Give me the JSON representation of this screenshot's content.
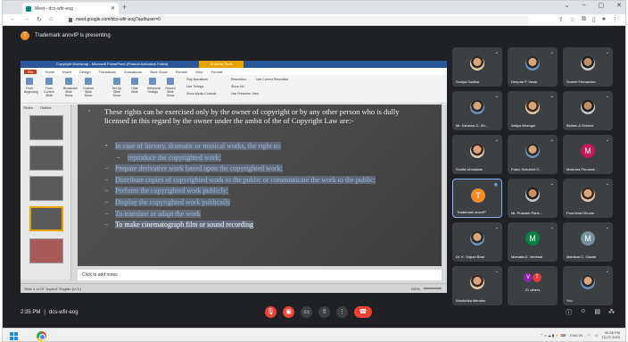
{
  "browser": {
    "tab_title": "Meet - dcs-wfir-eog",
    "url": "meet.google.com/dcs-wfir-eog?authuser=0"
  },
  "meet": {
    "presenter_initial": "T",
    "presenting_text": "Trademark anovIP is presenting",
    "time": "2:35 PM",
    "separator": "|",
    "meeting_code": "dcs-wfir-eog"
  },
  "powerpoint": {
    "title_bar": "Copyright Workshop - Microsoft PowerPoint (Product Activation Failed)",
    "drawing_tools": "Drawing Tools",
    "tabs": [
      "File",
      "Home",
      "Insert",
      "Design",
      "Transitions",
      "Animations",
      "Slide Show",
      "Review",
      "View",
      "Format"
    ],
    "ribbon_buttons": [
      "From Beginning",
      "From Current Slide",
      "Broadcast Slide Show",
      "Custom Slide Show",
      "Set Up Slide Show",
      "Hide Slide",
      "Rehearse Timings",
      "Record Slide Show"
    ],
    "ribbon_checks": [
      "Play Narrations",
      "Use Timings",
      "Show Media Controls",
      "Resolution:",
      "Use Current Resolution",
      "Show On:",
      "Use Presenter View"
    ],
    "pane_tabs": [
      "Slides",
      "Outline"
    ],
    "notes_placeholder": "Click to add notes",
    "status_left": "Slide 4 of 15    \"Aspect\"    English (U.S.)",
    "status_zoom": "100%",
    "slide": {
      "paragraph": "These rights can be exercised only by the owner of copyright  or by any other person who is dully licensed in this regard by the owner under the ambit of the of Copyright Law are:-",
      "lead": "In case of literary, dramatic or musical works, the right to:",
      "items": [
        "reproduce the copyrighted work;",
        "Prepare derivative work based upon the copyrighted work;",
        "Distribute copies of copyrighted work to the public or communicate the work to the public;",
        "Perform the copyrighted work publicly;",
        "Display the copyrighted work publically",
        "To translate or adapt the work",
        "To make cinematograph film or sound recording"
      ]
    }
  },
  "participants": [
    {
      "name": "Soniya Gadkar"
    },
    {
      "name": "Deepak P. Varak"
    },
    {
      "name": "Scarlet Fernandes"
    },
    {
      "name": "Mr. Kshama D. Dh..."
    },
    {
      "name": "Aditya Bhangui"
    },
    {
      "name": "Bidhan A Shinkre"
    },
    {
      "name": "Sunita Umraskar"
    },
    {
      "name": "Franz Schubert C..."
    },
    {
      "name": "Moshma Fernand...",
      "initial": "M"
    },
    {
      "name": "Trademark anovIP",
      "initial": "T"
    },
    {
      "name": "Mr. Prakash Parie..."
    },
    {
      "name": "Pournima Dhume"
    },
    {
      "name": "Dr. K. Sripad Bhat"
    },
    {
      "name": "Mamata D. Verlekar",
      "initial": "M"
    },
    {
      "name": "Manisha C. Gaude",
      "initial": "M"
    },
    {
      "name": "Ninotchka Mendes"
    },
    {
      "name": "21 others",
      "initials": [
        "V",
        "T"
      ]
    },
    {
      "name": "You"
    }
  ],
  "taskbar": {
    "lang": "ENG IN",
    "time": "02:35 PM",
    "date": "13-07-2023"
  },
  "colors": {
    "meet_bg": "#202124",
    "tile_bg": "#3c4043",
    "end_call": "#ea4335",
    "ppt_blue": "#2b579a",
    "ppt_file": "#c43e1c"
  }
}
